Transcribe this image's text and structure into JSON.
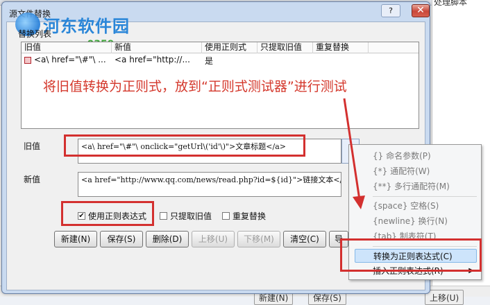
{
  "dialog": {
    "title": "源文件替换",
    "help": "?",
    "close": "✕"
  },
  "watermark": {
    "name": "河东软件园",
    "url": "www.pc0359.cn"
  },
  "list": {
    "group_label": "替换列表",
    "columns": [
      "旧值",
      "新值",
      "使用正则式",
      "只提取旧值",
      "重复替换"
    ],
    "rows": [
      {
        "old": "<a\\ href=\"\\#\"\\ ...",
        "new": "<a href=\"http://...",
        "regex": "是",
        "extract": "",
        "repeat": ""
      }
    ]
  },
  "annotation": "将旧值转换为正则式，放到“正则式测试器”进行测试",
  "old_label": "旧值",
  "old_value": "<a\\ href=\"\\#\"\\ onclick=\"getUrl\\('id'\\)\">文章标题</a>",
  "new_label": "新值",
  "new_value": "<a href=\"http://www.qq.com/news/read.php?id=${id}\">链接文本</a>",
  "options": {
    "use_regex": "使用正则表达式",
    "use_regex_checked": "✔",
    "extract_only": "只提取旧值",
    "repeat": "重复替换"
  },
  "buttons": {
    "new": "新建(N)",
    "save": "保存(S)",
    "delete": "删除(D)",
    "up": "上移(U)",
    "down": "下移(M)",
    "clear": "清空(C)",
    "more": "导"
  },
  "menu": {
    "items": [
      "{} 命名参数(P)",
      "{*} 通配符(W)",
      "{**} 多行通配符(M)",
      "{space} 空格(S)",
      "{newline} 换行(N)",
      "{tab} 制表符(T)",
      "转换为正则表达式(C)",
      "插入正则表达式(R)"
    ]
  },
  "background": {
    "right_text": "处理脚本",
    "btn1": "新建(N)",
    "btn2": "保存(S)",
    "btn3": "上移(U)"
  },
  "colors": {
    "highlight": "#d3302f"
  }
}
